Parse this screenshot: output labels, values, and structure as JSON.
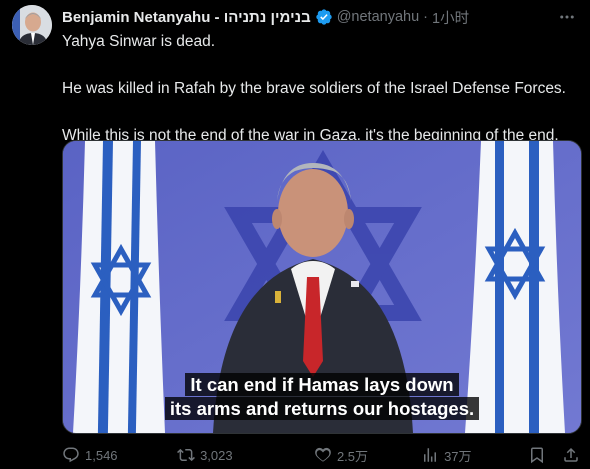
{
  "author": {
    "name": "Benjamin Netanyahu - בנימין נתניהו",
    "handle": "@netanyahu",
    "separator": "·",
    "time": "1小时"
  },
  "tweet": {
    "lines": [
      "Yahya Sinwar is dead.",
      "He was killed in Rafah by the brave soldiers of the Israel Defense Forces.",
      "While this is not the end of the war in Gaza, it's the beginning of the end."
    ]
  },
  "media": {
    "caption_line1": "It can end if Hamas lays down",
    "caption_line2": "its arms and returns our hostages."
  },
  "actions": {
    "replies": "1,546",
    "reposts": "3,023",
    "likes": "2.5万",
    "views": "37万"
  },
  "colors": {
    "background": "#000000",
    "text": "#e7e9ea",
    "muted": "#71767b",
    "verified": "#1d9bf0",
    "flag_blue": "#2b5fc0"
  }
}
